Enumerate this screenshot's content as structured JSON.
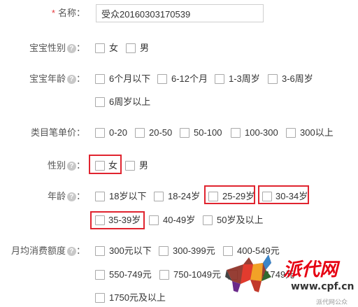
{
  "form": {
    "name": {
      "label": "名称：",
      "required_mark": "*",
      "value": "受众20160303170539"
    },
    "baby_gender": {
      "label": "宝宝性别",
      "help": "?",
      "colon": "：",
      "options": [
        "女",
        "男"
      ]
    },
    "baby_age": {
      "label": "宝宝年龄",
      "help": "?",
      "colon": "：",
      "options": [
        "6个月以下",
        "6-12个月",
        "1-3周岁",
        "3-6周岁",
        "6周岁以上"
      ]
    },
    "category_price": {
      "label": "类目笔单价：",
      "options": [
        "0-20",
        "20-50",
        "50-100",
        "100-300",
        "300以上"
      ]
    },
    "gender": {
      "label": "性别",
      "help": "?",
      "colon": "：",
      "options": [
        "女",
        "男"
      ]
    },
    "age": {
      "label": "年龄",
      "help": "?",
      "colon": "：",
      "options": [
        "18岁以下",
        "18-24岁",
        "25-29岁",
        "30-34岁",
        "35-39岁",
        "40-49岁",
        "50岁及以上"
      ]
    },
    "monthly_spend": {
      "label": "月均消费额度",
      "help": "?",
      "colon": "：",
      "options": [
        "300元以下",
        "300-399元",
        "400-549元",
        "550-749元",
        "750-1049元",
        "1050-1749元",
        "1750元及以上"
      ]
    }
  },
  "watermark": {
    "brand": "派代网",
    "url": "www.cpf.cn",
    "sub": "派代网公众"
  },
  "colors": {
    "highlight": "#e0242f",
    "required": "#e4393c"
  }
}
